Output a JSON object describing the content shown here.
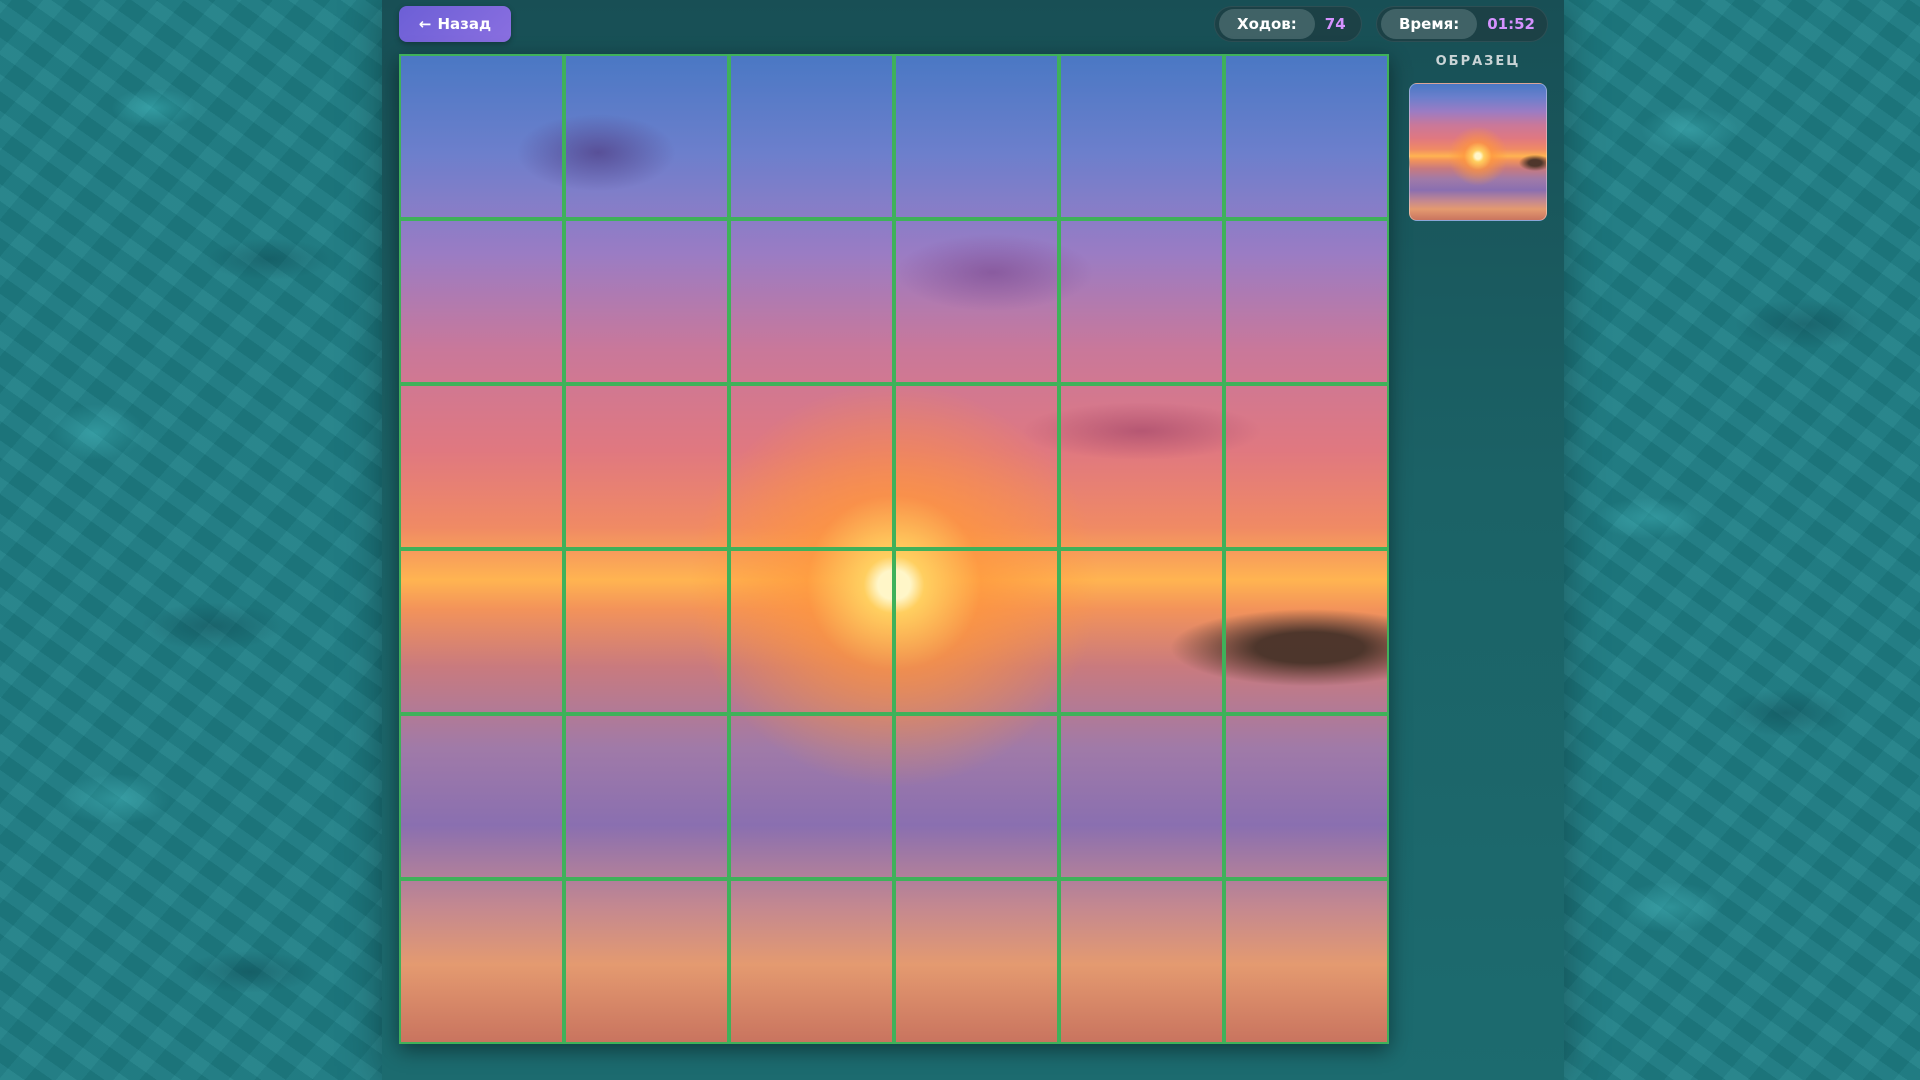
{
  "header": {
    "back_button": {
      "arrow": "←",
      "label": "Назад"
    },
    "moves": {
      "label": "Ходов:",
      "value": "74"
    },
    "time": {
      "label": "Время:",
      "value": "01:52"
    }
  },
  "sidebar": {
    "reference_label": "ОБРАЗЕЦ",
    "reference_image": "sunset-beach-thumbnail"
  },
  "puzzle": {
    "rows": 6,
    "cols": 6,
    "image": "sunset-over-ocean-beach",
    "tiles": [
      {
        "row": 0,
        "col": 0
      },
      {
        "row": 0,
        "col": 1
      },
      {
        "row": 0,
        "col": 2
      },
      {
        "row": 0,
        "col": 3
      },
      {
        "row": 0,
        "col": 4
      },
      {
        "row": 0,
        "col": 5
      },
      {
        "row": 1,
        "col": 0
      },
      {
        "row": 1,
        "col": 1
      },
      {
        "row": 1,
        "col": 2
      },
      {
        "row": 1,
        "col": 3
      },
      {
        "row": 1,
        "col": 4
      },
      {
        "row": 1,
        "col": 5
      },
      {
        "row": 2,
        "col": 0
      },
      {
        "row": 2,
        "col": 1
      },
      {
        "row": 2,
        "col": 2
      },
      {
        "row": 2,
        "col": 3
      },
      {
        "row": 2,
        "col": 4
      },
      {
        "row": 2,
        "col": 5
      },
      {
        "row": 3,
        "col": 0
      },
      {
        "row": 3,
        "col": 1
      },
      {
        "row": 3,
        "col": 2
      },
      {
        "row": 3,
        "col": 3
      },
      {
        "row": 3,
        "col": 4
      },
      {
        "row": 3,
        "col": 5
      },
      {
        "row": 4,
        "col": 0
      },
      {
        "row": 4,
        "col": 1
      },
      {
        "row": 4,
        "col": 2
      },
      {
        "row": 4,
        "col": 3
      },
      {
        "row": 4,
        "col": 4
      },
      {
        "row": 4,
        "col": 5
      },
      {
        "row": 5,
        "col": 0
      },
      {
        "row": 5,
        "col": 1
      },
      {
        "row": 5,
        "col": 2
      },
      {
        "row": 5,
        "col": 3
      },
      {
        "row": 5,
        "col": 4
      },
      {
        "row": 5,
        "col": 5
      }
    ]
  },
  "colors": {
    "accent": "#7a67dc",
    "stat_value": "#d592ff",
    "tile_border": "#3fb15a",
    "background": "#1e7f86"
  }
}
